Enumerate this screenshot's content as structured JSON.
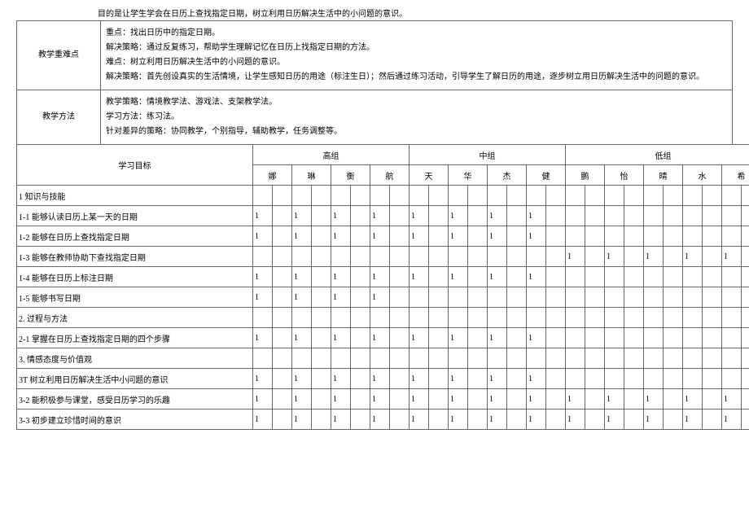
{
  "intro": "目的是让学生学会在日历上查找指定日期，树立利用日历解决生活中的小问题的意识。",
  "sections": {
    "keyDifficulty": {
      "label": "教学重难点",
      "lines": [
        "重点：找出日历中的指定日期。",
        "解决策略：通过反复练习，帮助学生理解记忆在日历上找指定日期的方法。",
        "难点：树立利用日历解决生活中的小问题的意识。",
        "解决策略：首先创设真实的生活情境，让学生感知日历的用途（标注生日）；然后通过练习活动，引导学生了解日历的用途，逐步树立用日历解决生活中的问题的意识。"
      ]
    },
    "methods": {
      "label": "教学方法",
      "lines": [
        "教学策略：情境教学法、游戏法、支架教学法。",
        "学习方法：练习法。",
        "针对差异的策略：协同教学，个别指导，辅助教学，任务调整等。"
      ]
    }
  },
  "tableHeaders": {
    "objectiveLabel": "学习目标",
    "groups": [
      {
        "name": "高组",
        "students": [
          "娜",
          "琳",
          "衡",
          "航"
        ]
      },
      {
        "name": "中组",
        "students": [
          "天",
          "华",
          "杰",
          "健"
        ]
      },
      {
        "name": "低组",
        "students": [
          "鹏",
          "怡",
          "晴",
          "水",
          "希"
        ]
      }
    ]
  },
  "rows": [
    {
      "label": "1 知识与技能",
      "cells": [
        "",
        "",
        "",
        "",
        "",
        "",
        "",
        "",
        "",
        "",
        "",
        "",
        "",
        "",
        "",
        "",
        "",
        "",
        "",
        "",
        "",
        "",
        "",
        "",
        "",
        ""
      ]
    },
    {
      "label": "1-1 能够认读日历上某一天的日期",
      "cells": [
        "1",
        "",
        "1",
        "",
        "1",
        "",
        "1",
        "",
        "1",
        "",
        "1",
        "",
        "1",
        "",
        "1",
        "",
        "",
        "",
        "",
        "",
        "",
        "",
        "",
        "",
        "",
        ""
      ]
    },
    {
      "label": "1-2 能够在日历上查找指定日期",
      "cells": [
        "1",
        "",
        "1",
        "",
        "1",
        "",
        "1",
        "",
        "1",
        "",
        "1",
        "",
        "1",
        "",
        "1",
        "",
        "",
        "",
        "",
        "",
        "",
        "",
        "",
        "",
        "",
        ""
      ]
    },
    {
      "label": "1-3 能够在教师协助下查找指定日期",
      "cells": [
        "",
        "",
        "",
        "",
        "",
        "",
        "",
        "",
        "",
        "",
        "",
        "",
        "",
        "",
        "",
        "",
        "1",
        "",
        "1",
        "",
        "1",
        "",
        "1",
        "",
        "1",
        ""
      ]
    },
    {
      "label": "1-4 能够在日历上标注日期",
      "cells": [
        "1",
        "",
        "1",
        "",
        "1",
        "",
        "1",
        "",
        "1",
        "",
        "1",
        "",
        "1",
        "",
        "1",
        "",
        "",
        "",
        "",
        "",
        "",
        "",
        "",
        "",
        "",
        ""
      ]
    },
    {
      "label": "1-5 能够书写日期",
      "cells": [
        "1",
        "",
        "1",
        "",
        "1",
        "",
        "1",
        "",
        "",
        "",
        "",
        "",
        "",
        "",
        "",
        "",
        "",
        "",
        "",
        "",
        "",
        "",
        "",
        "",
        "",
        ""
      ]
    },
    {
      "label": "2. 过程与方法",
      "cells": [
        "",
        "",
        "",
        "",
        "",
        "",
        "",
        "",
        "",
        "",
        "",
        "",
        "",
        "",
        "",
        "",
        "",
        "",
        "",
        "",
        "",
        "",
        "",
        "",
        "",
        ""
      ]
    },
    {
      "label": "2-1 掌握在日历上查找指定日期的四个步骤",
      "cells": [
        "1",
        "",
        "1",
        "",
        "1",
        "",
        "1",
        "",
        "1",
        "",
        "1",
        "",
        "1",
        "",
        "1",
        "",
        "",
        "",
        "",
        "",
        "",
        "",
        "",
        "",
        "",
        ""
      ]
    },
    {
      "label": "3. 情感态度与价值观",
      "cells": [
        "",
        "",
        "",
        "",
        "",
        "",
        "",
        "",
        "",
        "",
        "",
        "",
        "",
        "",
        "",
        "",
        "",
        "",
        "",
        "",
        "",
        "",
        "",
        "",
        "",
        ""
      ]
    },
    {
      "label": "3T 树立利用日历解决生活中小问题的意识",
      "cells": [
        "1",
        "",
        "1",
        "",
        "1",
        "",
        "1",
        "",
        "1",
        "",
        "1",
        "",
        "1",
        "",
        "1",
        "",
        "",
        "",
        "",
        "",
        "",
        "",
        "",
        "",
        "",
        ""
      ]
    },
    {
      "label": "3-2 能积极参与课堂，感受日历学习的乐趣",
      "cells": [
        "1",
        "",
        "1",
        "",
        "1",
        "",
        "1",
        "",
        "1",
        "",
        "1",
        "",
        "1",
        "",
        "1",
        "",
        "1",
        "",
        "1",
        "",
        "1",
        "",
        "1",
        "",
        "1",
        ""
      ]
    },
    {
      "label": "3-3 初步建立珍惜时间的意识",
      "cells": [
        "1",
        "",
        "1",
        "",
        "1",
        "",
        "1",
        "",
        "1",
        "",
        "1",
        "",
        "1",
        "",
        "1",
        "",
        "1",
        "",
        "1",
        "",
        "1",
        "",
        "1",
        "",
        "1",
        ""
      ]
    }
  ]
}
